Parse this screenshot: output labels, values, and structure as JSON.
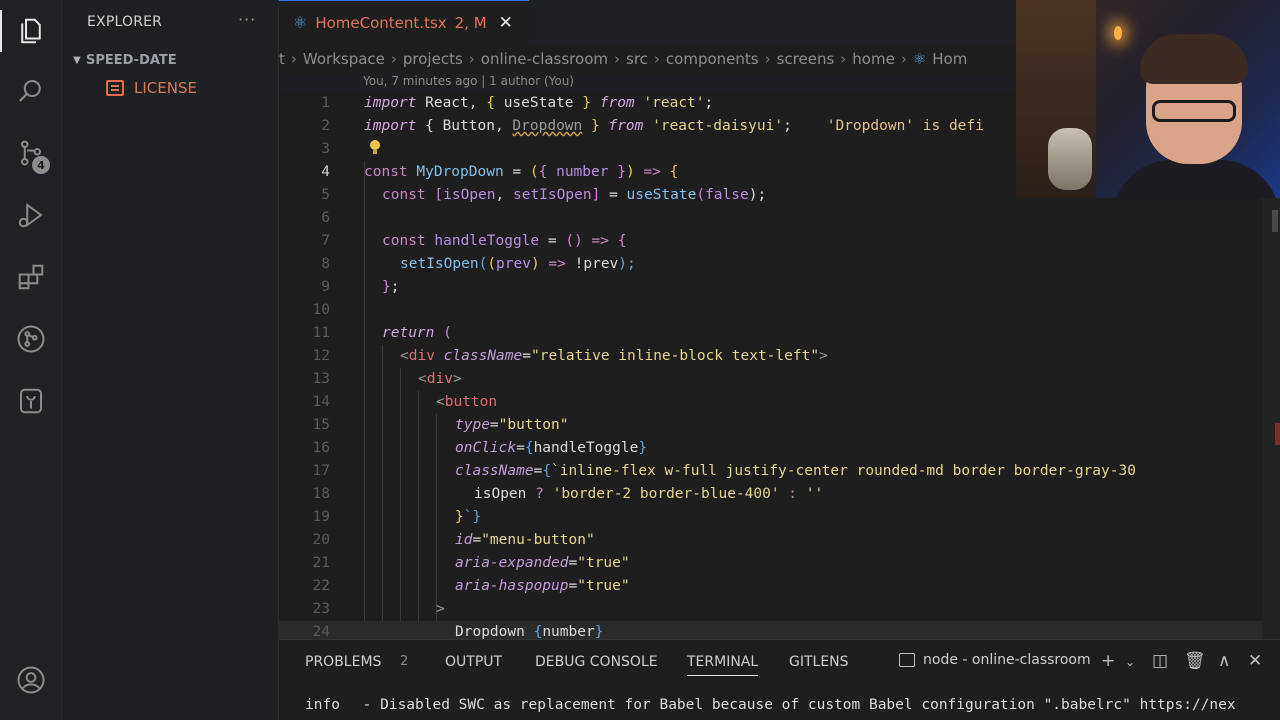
{
  "activity_bar": {
    "items": [
      {
        "icon": "files-icon",
        "active": true
      },
      {
        "icon": "search-icon"
      },
      {
        "icon": "source-control-icon",
        "badge": "4"
      },
      {
        "icon": "run-debug-icon"
      },
      {
        "icon": "extensions-icon"
      },
      {
        "icon": "git-graph-icon"
      },
      {
        "icon": "database-icon"
      },
      {
        "icon": "account-icon"
      }
    ]
  },
  "sidebar": {
    "title": "EXPLORER",
    "more": "···",
    "folder": "SPEED-DATE",
    "file": "LICENSE"
  },
  "tab": {
    "name": "HomeContent.tsx",
    "status": "2, M",
    "close": "✕"
  },
  "breadcrumb": [
    "t",
    "Workspace",
    "projects",
    "online-classroom",
    "src",
    "components",
    "screens",
    "home",
    "Hom"
  ],
  "blame": "You, 7 minutes ago | 1 author (You)",
  "line_numbers": [
    "1",
    "2",
    "3",
    "4",
    "5",
    "6",
    "7",
    "8",
    "9",
    "10",
    "11",
    "12",
    "13",
    "14",
    "15",
    "16",
    "17",
    "18",
    "19",
    "20",
    "21",
    "22",
    "23",
    "24"
  ],
  "code": {
    "l1": {
      "a": "import",
      "b": " React, ",
      "c": "{",
      "d": " useState ",
      "e": "}",
      "f": " from",
      "g": " 'react'",
      "h": ";"
    },
    "l2": {
      "a": "import",
      "b": " { Button, ",
      "c": "Dropdown",
      "d": " } ",
      "e": "from",
      "f": " 'react-daisyui'",
      "g": ";",
      "h": "    'Dropdown' is defi"
    },
    "l4": {
      "a": "const",
      "b": " MyDropDown",
      "c": " = ",
      "d": "(",
      "e": "{",
      "f": " number ",
      "g": "}",
      "h": ")",
      "i": " => ",
      "j": "{"
    },
    "l5": {
      "a": "const",
      "b": " [",
      "c": "isOpen",
      "d": ", ",
      "e": "setIsOpen",
      "f": "]",
      "g": " = ",
      "h": "useState",
      "i": "(",
      "j": "false",
      "k": ");"
    },
    "l7": {
      "a": "const",
      "b": " handleToggle",
      "c": " = ",
      "d": "()",
      "e": " => ",
      "f": "{"
    },
    "l8": {
      "a": "setIsOpen",
      "b": "(",
      "c": "(",
      "d": "prev",
      "e": ")",
      "f": " => ",
      "g": "!prev",
      "h": ");"
    },
    "l9": {
      "a": "}",
      "b": ";"
    },
    "l11": {
      "a": "return",
      "b": " ("
    },
    "l12": {
      "a": "<",
      "b": "div",
      "c": " className",
      "d": "=",
      "e": "\"relative inline-block text-left\"",
      "f": ">"
    },
    "l13": {
      "a": "<",
      "b": "div",
      "c": ">"
    },
    "l14": {
      "a": "<",
      "b": "button"
    },
    "l15": {
      "a": "type",
      "b": "=",
      "c": "\"button\""
    },
    "l16": {
      "a": "onClick",
      "b": "=",
      "c": "{",
      "d": "handleToggle",
      "e": "}"
    },
    "l17": {
      "a": "className",
      "b": "=",
      "c": "{",
      "d": "`inline-flex w-full justify-center rounded-md border border-gray-30"
    },
    "l18": {
      "a": "isOpen",
      "b": " ? ",
      "c": "'border-2 border-blue-400'",
      "d": " : ",
      "e": "''"
    },
    "l19": {
      "a": "}",
      "b": "`}"
    },
    "l20": {
      "a": "id",
      "b": "=",
      "c": "\"menu-button\""
    },
    "l21": {
      "a": "aria-expanded",
      "b": "=",
      "c": "\"true\""
    },
    "l22": {
      "a": "aria-haspopup",
      "b": "=",
      "c": "\"true\""
    },
    "l23": {
      "a": ">"
    },
    "l24": {
      "a": "Dropdown ",
      "b": "{",
      "c": "number",
      "d": "}"
    }
  },
  "panel": {
    "tabs": [
      "PROBLEMS",
      "OUTPUT",
      "DEBUG CONSOLE",
      "TERMINAL",
      "GITLENS"
    ],
    "problems_count": "2",
    "active_tab": "TERMINAL",
    "terminal_name": "node - online-classroom",
    "terminal_line_label": "info",
    "terminal_line_text": " - Disabled SWC as replacement for Babel because of custom Babel configuration \".babelrc\" https://nex"
  },
  "colors": {
    "accent": "#3a6df0",
    "modified_file": "#e2735a",
    "background": "#1e1e1e"
  }
}
